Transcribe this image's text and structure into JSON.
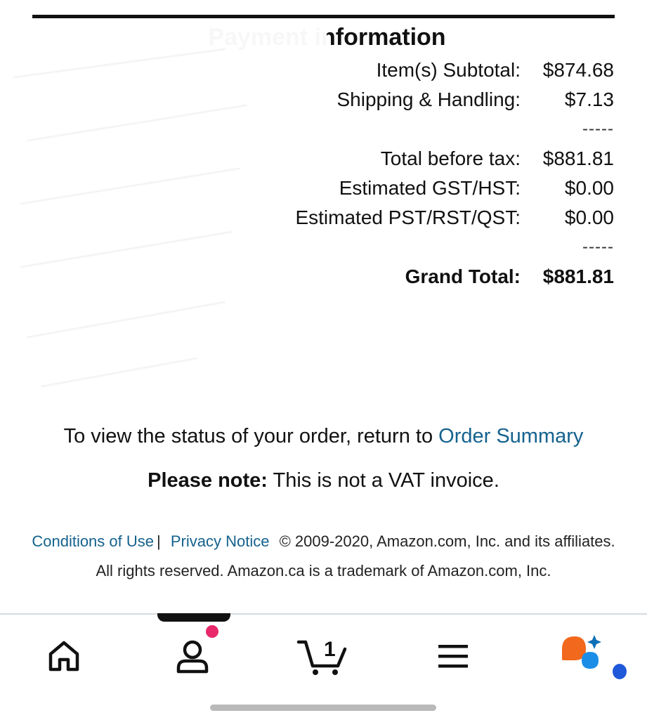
{
  "payment": {
    "title": "Payment information",
    "rows": [
      {
        "label": "Item(s) Subtotal:",
        "value": "$874.68"
      },
      {
        "label": "Shipping & Handling:",
        "value": "$7.13"
      },
      {
        "label": "Total before tax:",
        "value": "$881.81"
      },
      {
        "label": "Estimated GST/HST:",
        "value": "$0.00"
      },
      {
        "label": "Estimated PST/RST/QST:",
        "value": "$0.00"
      }
    ],
    "separator": "-----",
    "grand_total": {
      "label": "Grand Total:",
      "value": "$881.81"
    }
  },
  "status": {
    "text": "To view the status of your order, return to",
    "link": "Order Summary"
  },
  "note": {
    "bold": "Please note:",
    "text": "This is not a VAT invoice."
  },
  "footer": {
    "conditions": "Conditions of Use",
    "divider": "|",
    "privacy": "Privacy Notice",
    "copyright": "© 2009-2020, Amazon.com, Inc. and its affiliates.",
    "rights": "All rights reserved. Amazon.ca is a trademark of Amazon.com, Inc."
  },
  "nav": {
    "items": [
      "home-icon",
      "account-icon",
      "cart-icon",
      "menu-icon",
      "rufus-assistant-icon"
    ],
    "cart_count": "1"
  },
  "colors": {
    "link": "#15628e",
    "badge": "#e8286b",
    "assistant_orange": "#f2681c",
    "assistant_blue": "#1a8ee6"
  }
}
